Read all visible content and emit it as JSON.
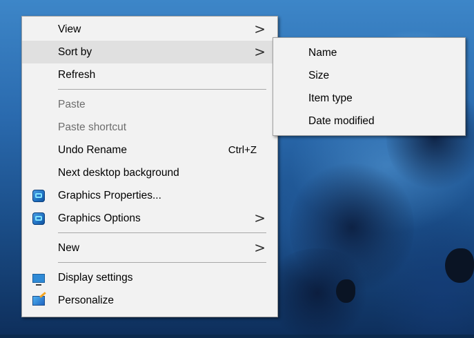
{
  "main_menu": {
    "items": [
      {
        "label": "View",
        "disabled": false,
        "submenu": true
      },
      {
        "label": "Sort by",
        "disabled": false,
        "submenu": true,
        "highlighted": true
      },
      {
        "label": "Refresh",
        "disabled": false
      },
      {
        "label": "Paste",
        "disabled": true
      },
      {
        "label": "Paste shortcut",
        "disabled": true
      },
      {
        "label": "Undo Rename",
        "disabled": false,
        "shortcut": "Ctrl+Z"
      },
      {
        "label": "Next desktop background",
        "disabled": false
      },
      {
        "label": "Graphics Properties...",
        "disabled": false,
        "icon": "graphics-icon"
      },
      {
        "label": "Graphics Options",
        "disabled": false,
        "icon": "graphics-icon",
        "submenu": true
      },
      {
        "label": "New",
        "disabled": false,
        "submenu": true
      },
      {
        "label": "Display settings",
        "disabled": false,
        "icon": "display-icon"
      },
      {
        "label": "Personalize",
        "disabled": false,
        "icon": "personalize-icon"
      }
    ],
    "arrow_glyph": ">"
  },
  "sort_submenu": {
    "items": [
      {
        "label": "Name"
      },
      {
        "label": "Size"
      },
      {
        "label": "Item type"
      },
      {
        "label": "Date modified"
      }
    ]
  },
  "colors": {
    "menu_background": "#f2f2f2",
    "highlight": "#e0e0e0",
    "disabled_text": "#6d6d6d"
  }
}
